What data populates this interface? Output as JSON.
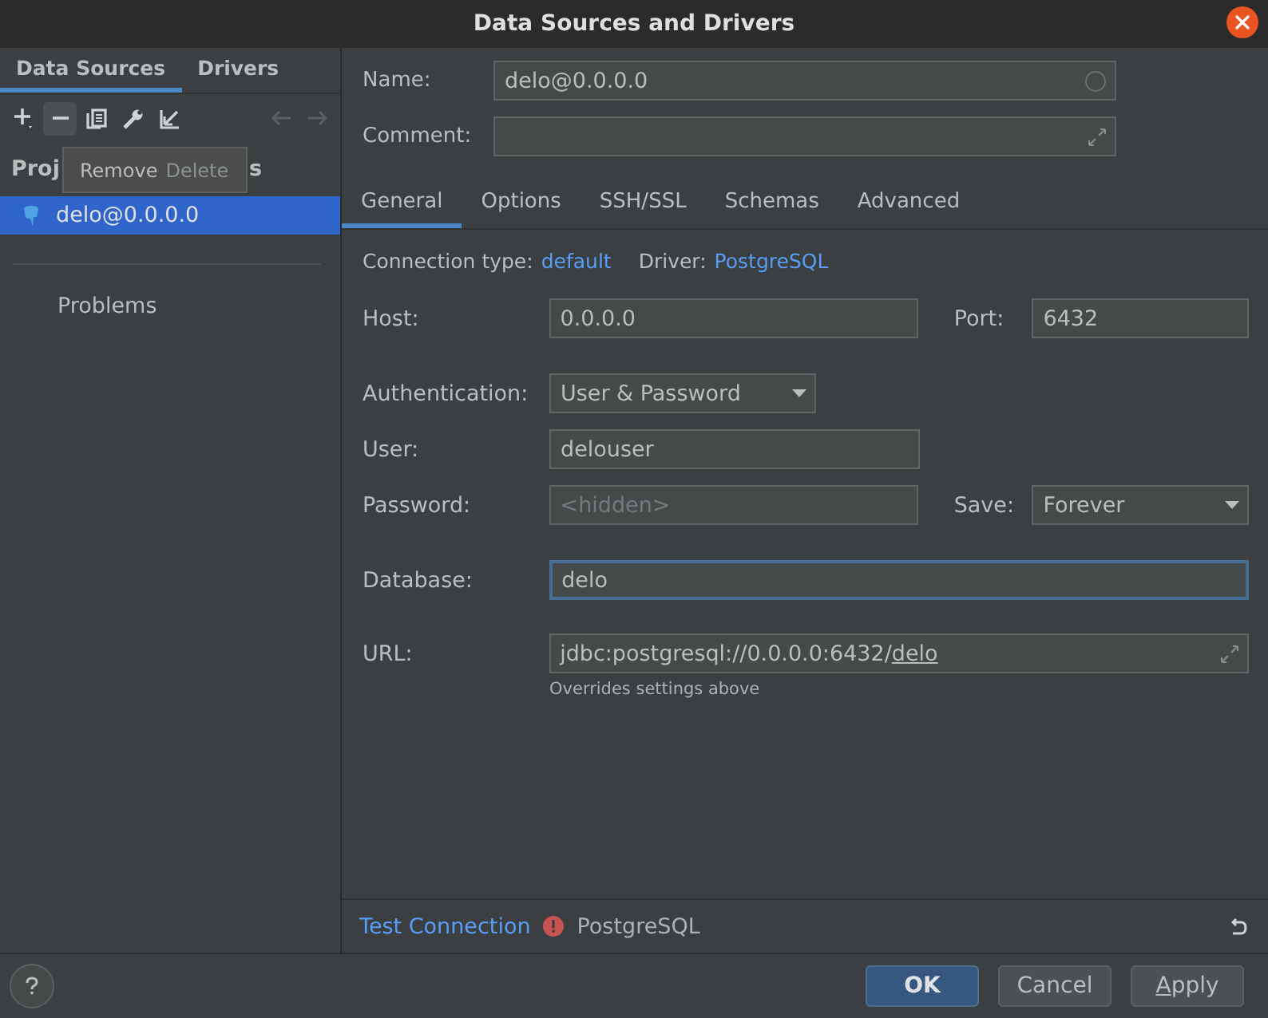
{
  "window": {
    "title": "Data Sources and Drivers"
  },
  "sidebar": {
    "tabs": [
      {
        "label": "Data Sources",
        "selected": true
      },
      {
        "label": "Drivers",
        "selected": false
      }
    ],
    "header_visible_start": "Proj",
    "header_visible_end": "s",
    "tooltip": {
      "label": "Remove",
      "shortcut": "Delete"
    },
    "items": [
      {
        "label": "delo@0.0.0.0",
        "selected": true
      }
    ],
    "problems": "Problems"
  },
  "name": {
    "label": "Name:",
    "value": "delo@0.0.0.0"
  },
  "comment": {
    "label": "Comment:"
  },
  "tabs": [
    {
      "label": "General",
      "selected": true
    },
    {
      "label": "Options",
      "selected": false
    },
    {
      "label": "SSH/SSL",
      "selected": false
    },
    {
      "label": "Schemas",
      "selected": false
    },
    {
      "label": "Advanced",
      "selected": false
    }
  ],
  "connection_type": {
    "label": "Connection type:",
    "value": "default"
  },
  "driver": {
    "label": "Driver:",
    "value": "PostgreSQL"
  },
  "host": {
    "label": "Host:",
    "value": "0.0.0.0"
  },
  "port": {
    "label": "Port:",
    "value": "6432"
  },
  "authentication": {
    "label": "Authentication:",
    "value": "User & Password"
  },
  "user": {
    "label": "User:",
    "value": "delouser"
  },
  "password": {
    "label": "Password:",
    "placeholder": "<hidden>"
  },
  "save": {
    "label": "Save:",
    "value": "Forever"
  },
  "database": {
    "label": "Database:",
    "value": "delo",
    "focused": true
  },
  "url": {
    "label": "URL:",
    "prefix": "jdbc:postgresql://0.0.0.0:6432/",
    "database_link": "delo",
    "hint": "Overrides settings above"
  },
  "status": {
    "test_connection": "Test Connection",
    "driver": "PostgreSQL"
  },
  "buttons": [
    {
      "label": "OK",
      "kind": "default"
    },
    {
      "label": "Cancel",
      "kind": "normal"
    },
    {
      "label": "Apply",
      "kind": "normal"
    }
  ]
}
